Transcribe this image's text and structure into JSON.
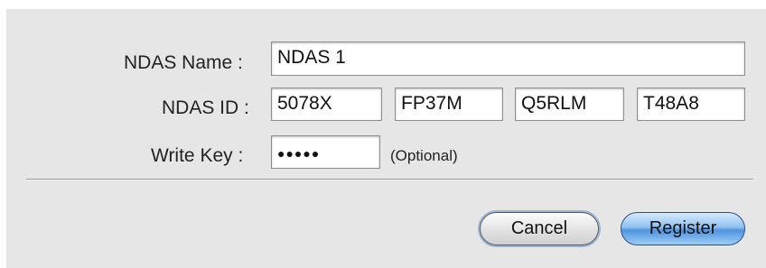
{
  "form": {
    "name_label": "NDAS Name :",
    "name_value": "NDAS 1",
    "id_label": "NDAS ID :",
    "id_parts": [
      "5078X",
      "FP37M",
      "Q5RLM",
      "T48A8"
    ],
    "write_key_label": "Write Key :",
    "write_key_value": "●●●●●",
    "optional_hint": "(Optional)"
  },
  "buttons": {
    "cancel_label": "Cancel",
    "register_label": "Register"
  }
}
